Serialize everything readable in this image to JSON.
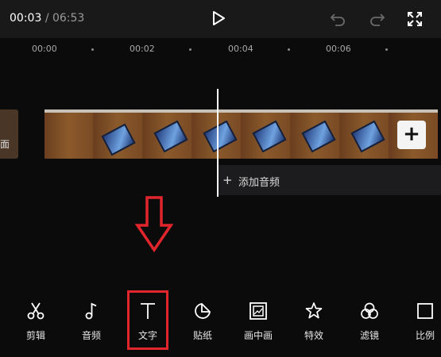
{
  "header": {
    "current_time": "00:03",
    "separator": "/",
    "duration": "06:53",
    "icons": [
      "play-icon",
      "undo-icon",
      "redo-icon",
      "fullscreen-icon"
    ]
  },
  "ruler": {
    "labels": [
      "00:00",
      "00:02",
      "00:04",
      "00:06"
    ]
  },
  "timeline": {
    "prev_clip_text": "面",
    "add_clip_symbol": "+",
    "add_audio_label": "添加音频",
    "add_audio_symbol": "+"
  },
  "toolbar": {
    "items": [
      {
        "label": "剪辑",
        "icon": "scissors-icon"
      },
      {
        "label": "音频",
        "icon": "music-note-icon"
      },
      {
        "label": "文字",
        "icon": "text-icon"
      },
      {
        "label": "贴纸",
        "icon": "sticker-icon"
      },
      {
        "label": "画中画",
        "icon": "picture-in-picture-icon"
      },
      {
        "label": "特效",
        "icon": "effects-star-icon"
      },
      {
        "label": "滤镜",
        "icon": "filter-icon"
      },
      {
        "label": "比例",
        "icon": "ratio-icon"
      }
    ]
  },
  "annotation": {
    "arrow_color": "#e0262c",
    "highlight_color": "#e0262c"
  }
}
